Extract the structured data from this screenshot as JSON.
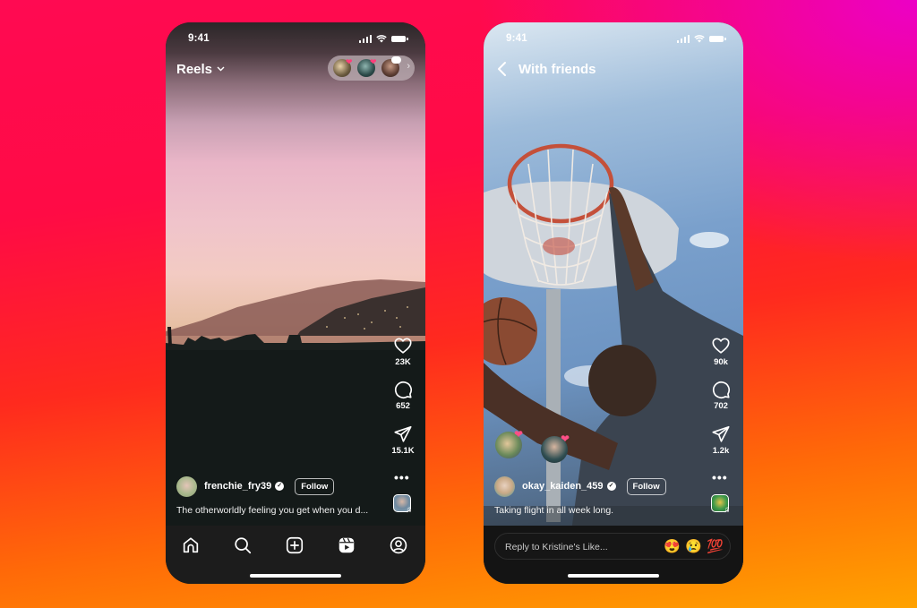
{
  "phones": {
    "left": {
      "status": {
        "time": "9:41"
      },
      "header": {
        "title": "Reels",
        "dropdown_icon": "chevron-down-icon"
      },
      "friends_pill": {
        "avatars": [
          "friend-avatar-1",
          "friend-avatar-2",
          "friend-avatar-3"
        ],
        "chevron": "›"
      },
      "actions": {
        "like_count": "23K",
        "comment_count": "652",
        "share_count": "15.1K",
        "more": "•••",
        "music_note": "♫"
      },
      "author": {
        "username": "frenchie_fry39",
        "verified": "✓",
        "follow_label": "Follow"
      },
      "caption": "The otherworldly feeling you get when you d...",
      "nav": [
        "home",
        "search",
        "create",
        "reels",
        "profile"
      ]
    },
    "right": {
      "status": {
        "time": "9:41"
      },
      "header": {
        "title": "With friends",
        "back_icon": "chevron-left-icon"
      },
      "actions": {
        "like_count": "90k",
        "comment_count": "702",
        "share_count": "1.2k",
        "more": "•••",
        "music_note": "♫"
      },
      "author": {
        "username": "okay_kaiden_459",
        "verified": "✓",
        "follow_label": "Follow"
      },
      "caption": "Taking flight in all week long.",
      "reply": {
        "placeholder": "Reply to Kristine's Like...",
        "emojis": [
          "😍",
          "😢",
          "💯"
        ]
      }
    }
  },
  "colors": {
    "accent_heart": "#ff3d7a",
    "background_top": "#ff0a52",
    "background_bottom": "#ffa200"
  }
}
